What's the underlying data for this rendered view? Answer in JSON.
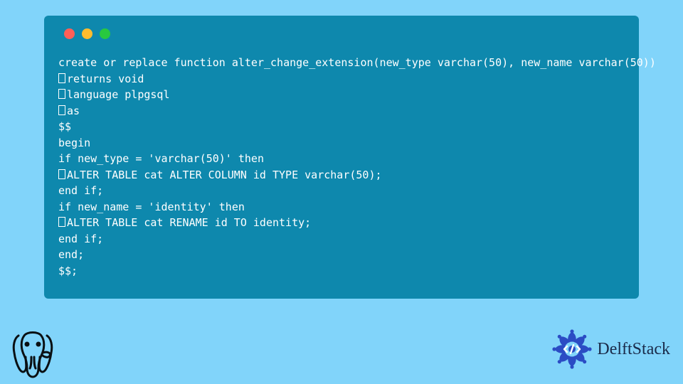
{
  "code": {
    "lines": [
      {
        "prefix": "",
        "text": "create or replace function alter_change_extension(new_type varchar(50), new_name varchar(50))"
      },
      {
        "prefix": "tofu",
        "text": "returns void"
      },
      {
        "prefix": "tofu",
        "text": "language plpgsql"
      },
      {
        "prefix": "tofu",
        "text": "as"
      },
      {
        "prefix": "",
        "text": "$$"
      },
      {
        "prefix": "",
        "text": "begin"
      },
      {
        "prefix": "",
        "text": "if new_type = 'varchar(50)' then"
      },
      {
        "prefix": "tofu",
        "text": "ALTER TABLE cat ALTER COLUMN id TYPE varchar(50);"
      },
      {
        "prefix": "",
        "text": "end if;"
      },
      {
        "prefix": "",
        "text": "if new_name = 'identity' then"
      },
      {
        "prefix": "tofu",
        "text": "ALTER TABLE cat RENAME id TO identity;"
      },
      {
        "prefix": "",
        "text": "end if;"
      },
      {
        "prefix": "",
        "text": "end;"
      },
      {
        "prefix": "",
        "text": "$$;"
      }
    ]
  },
  "brand": {
    "name": "DelftStack"
  },
  "colors": {
    "page_bg": "#81d4fa",
    "window_bg": "#0e88ad",
    "code_text": "#ffffff",
    "brand_text": "#1a2b4a",
    "brand_accent": "#2b4cc4"
  }
}
